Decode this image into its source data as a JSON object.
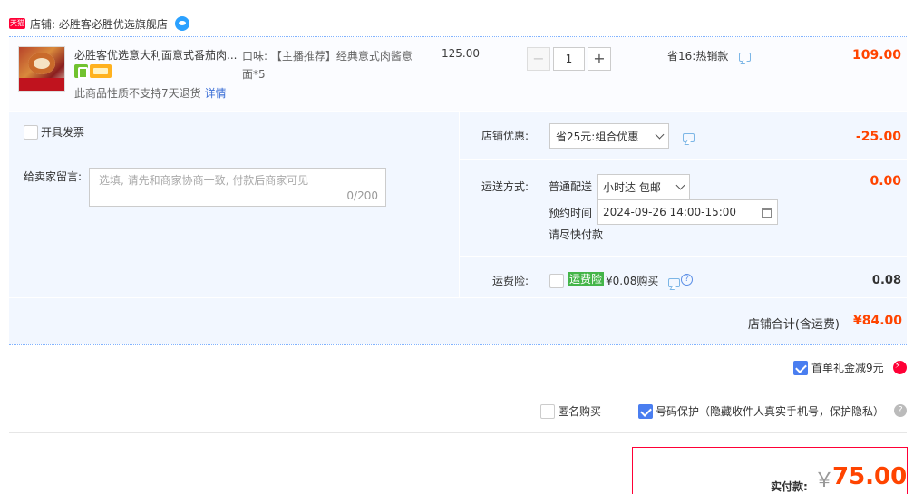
{
  "shop": {
    "badge": "天猫",
    "label": "店铺: 必胜客必胜优选旗舰店"
  },
  "item": {
    "title": "必胜客优选意大利面意式番茄肉...",
    "notice": "此商品性质不支持7天退货",
    "notice_link": "详情",
    "sku": "口味: 【主播推荐】经典意式肉酱意面*5",
    "unit_price": "125.00",
    "qty": "1",
    "qty_minus": "−",
    "qty_plus": "+",
    "save": "省16:热销款",
    "total": "109.00"
  },
  "invoice": {
    "label": "开具发票"
  },
  "remark": {
    "label": "给卖家留言:",
    "placeholder": "选填, 请先和商家协商一致, 付款后商家可见",
    "count": "0/200"
  },
  "shop_discount": {
    "label": "店铺优惠:",
    "value": "省25元:组合优惠",
    "amount": "-25.00"
  },
  "shipping": {
    "label": "运送方式:",
    "method": "普通配送",
    "option": "小时达 包邮",
    "time_label": "预约时间",
    "time_value": "2024-09-26 14:00-15:00",
    "note": "请尽快付款",
    "amount": "0.00"
  },
  "insurance": {
    "label": "运费险:",
    "tag": "运费险",
    "price": "¥0.08购买",
    "amount": "0.08"
  },
  "store_total": {
    "label": "店铺合计(含运费)",
    "amount": "¥84.00"
  },
  "first_gift": {
    "label": "首单礼金减9元"
  },
  "anonymous": {
    "label": "匿名购买"
  },
  "number_protect": {
    "label": "号码保护（隐藏收件人真实手机号，保护隐私）"
  },
  "pay": {
    "label": "实付款:",
    "currency": "￥",
    "amount": "75.00"
  },
  "colors": {
    "accent": "#ff4400",
    "border_red": "#ff0036",
    "blue": "#4a7ef0",
    "panel_bg": "#f2f7ff"
  }
}
